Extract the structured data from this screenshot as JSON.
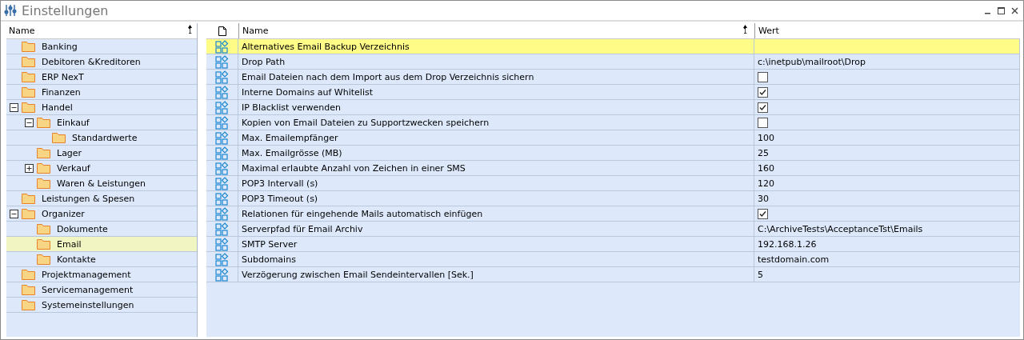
{
  "window": {
    "title": "Einstellungen"
  },
  "tree": {
    "column": {
      "label": "Name",
      "sort_order": "1"
    },
    "items": [
      {
        "label": "Banking",
        "selected": false
      },
      {
        "label": "Debitoren &Kreditoren",
        "selected": false
      },
      {
        "label": "ERP NexT",
        "selected": false
      },
      {
        "label": "Finanzen",
        "selected": false
      },
      {
        "label": "Handel",
        "selected": false,
        "expanded": true,
        "children": [
          {
            "label": "Einkauf",
            "selected": false,
            "expanded": true,
            "children": [
              {
                "label": "Standardwerte",
                "selected": false
              }
            ]
          },
          {
            "label": "Lager",
            "selected": false
          },
          {
            "label": "Verkauf",
            "selected": false,
            "expanded": false
          },
          {
            "label": "Waren & Leistungen",
            "selected": false
          }
        ]
      },
      {
        "label": "Leistungen & Spesen",
        "selected": false
      },
      {
        "label": "Organizer",
        "selected": false,
        "expanded": true,
        "children": [
          {
            "label": "Dokumente",
            "selected": false
          },
          {
            "label": "Email",
            "selected": true
          },
          {
            "label": "Kontakte",
            "selected": false
          }
        ]
      },
      {
        "label": "Projektmanagement",
        "selected": false
      },
      {
        "label": "Servicemanagement",
        "selected": false
      },
      {
        "label": "Systemeinstellungen",
        "selected": false
      }
    ]
  },
  "table": {
    "columns": [
      {
        "label": "Name",
        "sort_order": "1"
      },
      {
        "label": "Wert"
      }
    ],
    "rows": [
      {
        "name": "Alternatives Email Backup Verzeichnis",
        "kind": "text",
        "value": "",
        "selected": true
      },
      {
        "name": "Drop Path",
        "kind": "text",
        "value": "c:\\inetpub\\mailroot\\Drop",
        "selected": false
      },
      {
        "name": "Email Dateien nach dem Import aus dem Drop Verzeichnis sichern",
        "kind": "checkbox",
        "checked": false,
        "selected": false
      },
      {
        "name": "Interne Domains auf Whitelist",
        "kind": "checkbox",
        "checked": true,
        "selected": false
      },
      {
        "name": "IP Blacklist verwenden",
        "kind": "checkbox",
        "checked": true,
        "selected": false
      },
      {
        "name": "Kopien von Email Dateien zu Supportzwecken speichern",
        "kind": "checkbox",
        "checked": false,
        "selected": false
      },
      {
        "name": "Max. Emailempfänger",
        "kind": "text",
        "value": "100",
        "selected": false
      },
      {
        "name": "Max. Emailgrösse (MB)",
        "kind": "text",
        "value": "25",
        "selected": false
      },
      {
        "name": "Maximal erlaubte Anzahl von Zeichen in einer SMS",
        "kind": "text",
        "value": "160",
        "selected": false
      },
      {
        "name": "POP3 Intervall (s)",
        "kind": "text",
        "value": "120",
        "selected": false
      },
      {
        "name": "POP3 Timeout (s)",
        "kind": "text",
        "value": "30",
        "selected": false
      },
      {
        "name": "Relationen für eingehende Mails automatisch einfügen",
        "kind": "checkbox",
        "checked": true,
        "selected": false
      },
      {
        "name": "Serverpfad für Email Archiv",
        "kind": "text",
        "value": "C:\\ArchiveTests\\AcceptanceTst\\Emails",
        "selected": false
      },
      {
        "name": "SMTP Server",
        "kind": "text",
        "value": "192.168.1.26",
        "selected": false
      },
      {
        "name": "Subdomains",
        "kind": "text",
        "value": "testdomain.com",
        "selected": false
      },
      {
        "name": "Verzögerung zwischen Email Sendeintervallen [Sek.]",
        "kind": "text",
        "value": "5",
        "selected": false
      }
    ]
  }
}
